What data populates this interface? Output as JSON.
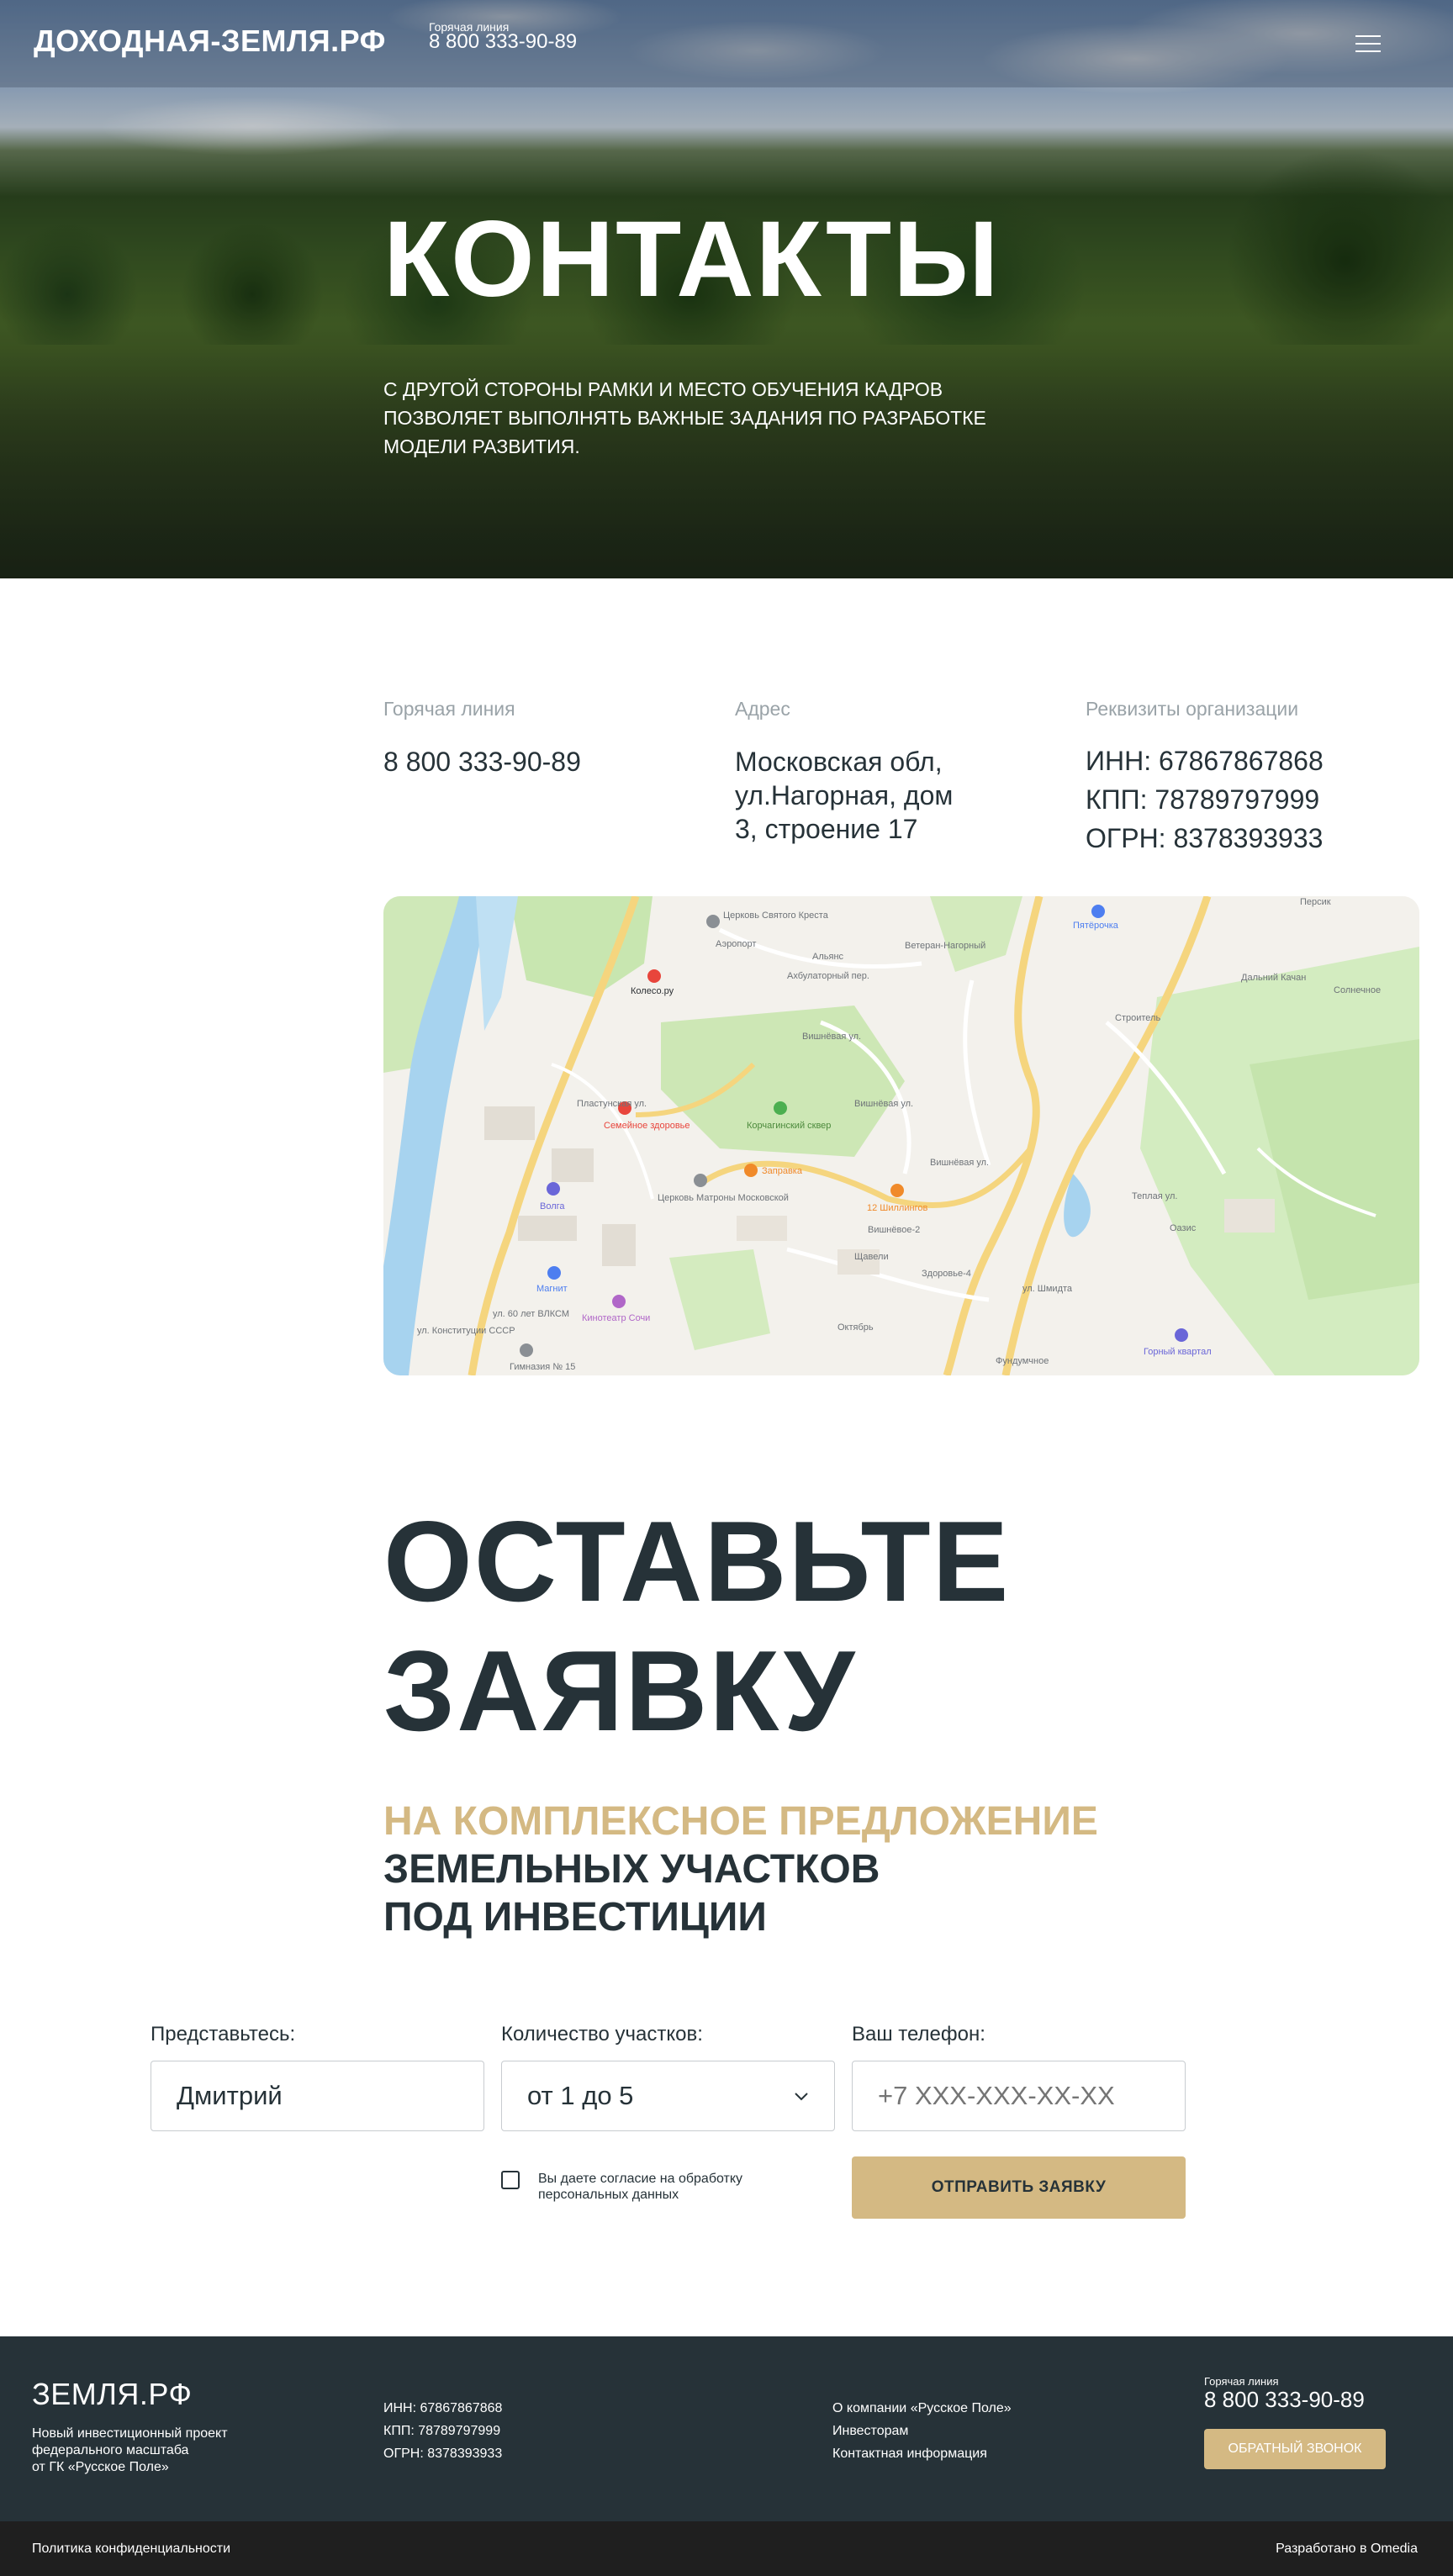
{
  "header": {
    "logo": "ДОХОДНАЯ-ЗЕМЛЯ.РФ",
    "hotline_label": "Горячая линия",
    "hotline_phone": "8 800 333-90-89",
    "menu_icon": "hamburger-icon"
  },
  "hero": {
    "title": "КОНТАКТЫ",
    "subtitle": "С ДРУГОЙ СТОРОНЫ РАМКИ И МЕСТО ОБУЧЕНИЯ КАДРОВ ПОЗВОЛЯЕТ ВЫПОЛНЯТЬ ВАЖНЫЕ ЗАДАНИЯ ПО РАЗРАБОТКЕ МОДЕЛИ РАЗВИТИЯ."
  },
  "contacts": {
    "hotline": {
      "label": "Горячая линия",
      "value": "8 800 333-90-89"
    },
    "address": {
      "label": "Адрес",
      "lines": [
        "Московская обл,",
        "ул.Нагорная, дом",
        "3, строение 17"
      ]
    },
    "requisites": {
      "label": "Реквизиты организации",
      "lines": [
        "ИНН: 67867867868",
        "КПП: 78789797999",
        "ОГРН: 8378393933"
      ]
    }
  },
  "map": {
    "labels": [
      "Церковь Святого Креста",
      "Альянс",
      "Ветеран-Нагорный",
      "Пятёрочка",
      "Персик",
      "Дальний Качан",
      "Солнечное",
      "Колесо.ру",
      "Аэропорт",
      "Ахбулаторный пер.",
      "Вишнёвая ул.",
      "Строитель",
      "Пластунская ул.",
      "Семейное здоровье",
      "Корчагинский сквер",
      "Заправка",
      "12 Шиллингов",
      "Вишнёвая ул.",
      "Волга",
      "Церковь Матроны Московской",
      "Вишнёвое-2",
      "Щавели",
      "Магнит",
      "Здоровье-4",
      "Теплая ул.",
      "Оазис",
      "ул. Конституции СССР",
      "ул. 60 лет ВЛКСМ",
      "Кинотеатр Сочи",
      "Октябрь",
      "Гимназия № 15",
      "Фундумчное",
      "Горный квартал",
      "ул. Шмидта",
      "Вишнёвая ул."
    ]
  },
  "request": {
    "title_line1": "ОСТАВЬТЕ",
    "title_line2": "ЗАЯВКУ",
    "subtitle_gold": "НА КОМПЛЕКСНОЕ ПРЕДЛОЖЕНИЕ",
    "subtitle_dark1": "ЗЕМЕЛЬНЫХ УЧАСТКОВ",
    "subtitle_dark2": "ПОД ИНВЕСТИЦИИ"
  },
  "form": {
    "name_label": "Представьтесь:",
    "name_value": "Дмитрий",
    "count_label": "Количество участков:",
    "count_value": "от 1 до 5",
    "phone_label": "Ваш телефон:",
    "phone_placeholder": "+7 XXX-XXX-XX-XX",
    "consent": "Вы даете согласие на обработку персональных данных",
    "submit": "ОТПРАВИТЬ ЗАЯВКУ"
  },
  "footer": {
    "logo": "ЗЕМЛЯ.РФ",
    "desc": [
      "Новый инвестиционный проект",
      "федерального масштаба",
      "от ГК «Русское Поле»"
    ],
    "requisites": [
      "ИНН: 67867867868",
      "КПП: 78789797999",
      "ОГРН: 8378393933"
    ],
    "links": [
      "О компании «Русское Поле»",
      "Инвесторам",
      "Контактная информация"
    ],
    "hotline_label": "Горячая линия",
    "hotline_phone": "8 800 333-90-89",
    "callback": "ОБРАТНЫЙ ЗВОНОК",
    "privacy": "Политика конфиденциальности",
    "developer": "Разработано в Omedia"
  },
  "colors": {
    "accent": "#d4b983",
    "dark": "#263238",
    "muted": "#9aa3a8"
  }
}
